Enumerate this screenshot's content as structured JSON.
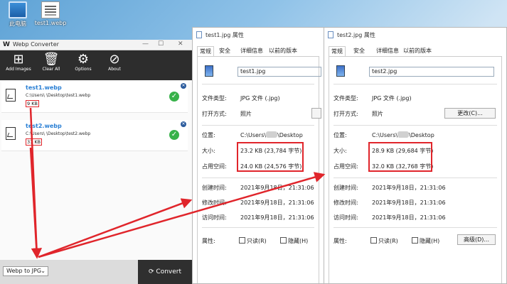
{
  "desktop": {
    "icons": [
      {
        "label": "此电脑"
      },
      {
        "label": "test1.webp"
      }
    ]
  },
  "converter": {
    "title": "Webp Converter",
    "toolbar": [
      {
        "label": "Add Images",
        "icon": "add-images-icon"
      },
      {
        "label": "Clear All",
        "icon": "trash-icon"
      },
      {
        "label": "Options",
        "icon": "gear-icon"
      },
      {
        "label": "About",
        "icon": "compass-icon"
      }
    ],
    "items": [
      {
        "name": "test1.webp",
        "path": "C:\\Users\\      \\Desktop\\test1.webp",
        "size": "9 KB"
      },
      {
        "name": "test2.webp",
        "path": "C:\\Users\\      \\Desktop\\test2.webp",
        "size": "31 KB"
      }
    ],
    "format": "Webp to JPG",
    "convert_label": "Convert"
  },
  "dialogs": [
    {
      "title": "test1.jpg 属性",
      "tabs": [
        "常规",
        "安全",
        "详细信息",
        "以前的版本"
      ],
      "filename": "test1.jpg",
      "labels": {
        "type": "文件类型:",
        "open": "打开方式:",
        "location": "位置:",
        "size": "大小:",
        "disk": "占用空间:",
        "created": "创建时间:",
        "modified": "修改时间:",
        "accessed": "访问时间:",
        "attr": "属性:"
      },
      "type": "JPG 文件 (.jpg)",
      "open_with": "照片",
      "location_a": "C:\\Users\\",
      "location_b": "\\Desktop",
      "size": "23.2 KB (23,784 字节)",
      "disk": "24.0 KB (24,576 字节)",
      "created": "2021年9月18日，21:31:06",
      "modified": "2021年9月18日，21:31:06",
      "accessed": "2021年9月18日，21:31:06",
      "readonly": "只读(R)",
      "hidden": "隐藏(H)"
    },
    {
      "title": "test2.jpg 属性",
      "tabs": [
        "常规",
        "安全",
        "详细信息",
        "以前的版本"
      ],
      "filename": "test2.jpg",
      "labels": {
        "type": "文件类型:",
        "open": "打开方式:",
        "location": "位置:",
        "size": "大小:",
        "disk": "占用空间:",
        "created": "创建时间:",
        "modified": "修改时间:",
        "accessed": "访问时间:",
        "attr": "属性:"
      },
      "type": "JPG 文件 (.jpg)",
      "open_with": "照片",
      "change_label": "更改(C)...",
      "location_a": "C:\\Users\\",
      "location_b": "\\Desktop",
      "size": "28.9 KB (29,684 字节)",
      "disk": "32.0 KB (32,768 字节)",
      "created": "2021年9月18日，21:31:06",
      "modified": "2021年9月18日，21:31:06",
      "accessed": "2021年9月18日，21:31:06",
      "readonly": "只读(R)",
      "hidden": "隐藏(H)",
      "advanced_label": "高级(D)..."
    }
  ],
  "colors": {
    "highlight": "#e0252b",
    "link": "#2a7fd4",
    "success": "#38b24a"
  }
}
